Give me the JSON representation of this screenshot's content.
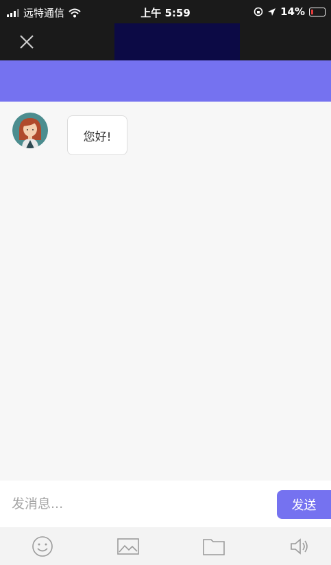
{
  "status_bar": {
    "carrier": "远特通信",
    "time": "上午 5:59",
    "battery": "14%"
  },
  "colors": {
    "dark_bar": "#1a1a1a",
    "title_block": "#0c0a45",
    "header_band": "#7572f0",
    "accent": "#7572f0",
    "avatar_bg": "#4c8d8f"
  },
  "chat": {
    "messages": [
      {
        "sender": "agent",
        "avatar": "female-avatar-icon",
        "text": "您好!"
      }
    ]
  },
  "composer": {
    "placeholder": "发消息...",
    "value": "",
    "send_label": "发送"
  },
  "toolbar": {
    "items": [
      "emoji-icon",
      "image-icon",
      "folder-icon",
      "speaker-icon"
    ]
  }
}
